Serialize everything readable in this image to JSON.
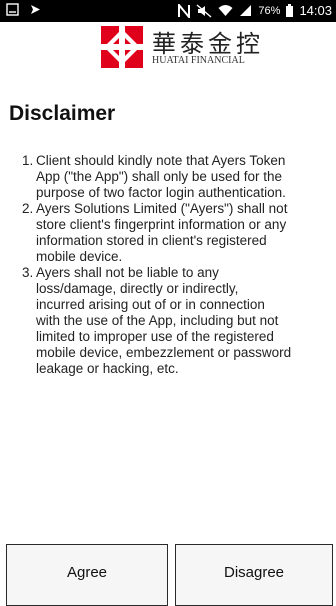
{
  "status_bar": {
    "battery_percent": "76%",
    "time": "14:03",
    "icons": [
      "screenshot-icon",
      "cast-icon",
      "nfc-icon",
      "mute-icon",
      "wifi-icon",
      "signal-icon",
      "battery-icon"
    ]
  },
  "header": {
    "logo_chinese": "華泰金控",
    "logo_english": "HUATAI FINANCIAL",
    "brand_color": "#e0001b"
  },
  "page": {
    "title": "Disclaimer",
    "items": [
      {
        "number": "1.",
        "lines": [
          "Client should kindly note that Ayers Token",
          "App (\"the App\") shall only be used for the",
          "purpose of two factor login authentication."
        ]
      },
      {
        "number": "2.",
        "lines": [
          "Ayers Solutions Limited (\"Ayers\") shall not",
          "store client's fingerprint information or any",
          "information stored in client's registered",
          "mobile device."
        ]
      },
      {
        "number": "3.",
        "lines": [
          "Ayers shall not be liable to any",
          "loss/damage, directly or indirectly,",
          "incurred arising out of or in connection",
          "with the use of the App, including but not",
          "limited to improper use of the registered",
          "mobile device, embezzlement or password",
          "leakage or hacking, etc."
        ]
      }
    ]
  },
  "buttons": {
    "agree": "Agree",
    "disagree": "Disagree"
  }
}
